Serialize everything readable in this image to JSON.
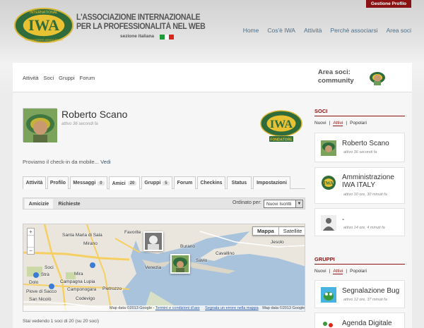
{
  "header": {
    "gestione_label": "Gestione Profilo",
    "title_line1": "L'ASSOCIAZIONE INTERNAZIONALE",
    "title_line2": "PER LA PROFESSIONALITÀ NEL WEB",
    "subtitle": "sezione italiana",
    "logo_text": "IWA",
    "logo_ring_top": "INTERNATIONAL",
    "logo_ring_bottom": "WEBMASTERS ASSOCIATION",
    "nav": [
      "Home",
      "Cos'è IWA",
      "Attività",
      "Perchè associarsi",
      "Area soci"
    ]
  },
  "subnav": {
    "links": [
      "Attività",
      "Soci",
      "Gruppi",
      "Forum"
    ],
    "area_label_line1": "Area soci:",
    "area_label_line2": "community"
  },
  "profile": {
    "name": "Roberto Scano",
    "activity": "attivo 36 secondi fa",
    "badge_label": "FONDATORE",
    "status_text": "Proviamo il check-in da mobile...",
    "status_link": "Vedi"
  },
  "tabs": [
    {
      "label": "Attività",
      "count": ""
    },
    {
      "label": "Profilo",
      "count": ""
    },
    {
      "label": "Messaggi",
      "count": "0"
    },
    {
      "label": "Amici",
      "count": "20"
    },
    {
      "label": "Gruppi",
      "count": "5"
    },
    {
      "label": "Forum",
      "count": ""
    },
    {
      "label": "Checkins",
      "count": ""
    },
    {
      "label": "Status",
      "count": ""
    },
    {
      "label": "Impostazioni",
      "count": ""
    }
  ],
  "subtabs": [
    "Amicizie",
    "Richieste"
  ],
  "order": {
    "label": "Ordinato per:",
    "selected": "Nuovi Iscritti"
  },
  "map": {
    "type_map": "Mappa",
    "type_sat": "Satellite",
    "labels": [
      "Santa Maria di Sala",
      "Mirano",
      "Favorite",
      "Burano",
      "Jesolo",
      "Venezia",
      "Cavallino",
      "Savio",
      "Soci",
      "Mira",
      "Dolo",
      "Strà",
      "Campagna Lupia",
      "Camponogara",
      "Piove di Sacco",
      "Codevigo",
      "San Nicolò",
      "Pietrozzo"
    ],
    "footer_data": "Map data ©2013 Google",
    "footer_terms": "Termini e condizioni d'uso",
    "footer_report": "Segnala un errore nella mappa",
    "footer_data2": "Map data ©2013 Google",
    "colors": {
      "water": "#a9c3dd",
      "land": "#eae6dd",
      "road": "#f6cf62"
    }
  },
  "members_count": "Stai vedendo 1 soci di 20 (su 20 soci)",
  "sidebar": {
    "soci_header": "SOCI",
    "soci_filters": [
      "Nuovi",
      "Attivi",
      "Popolari"
    ],
    "soci_active_filter": "Attivi",
    "members": [
      {
        "name": "Roberto Scano",
        "time": "attivo 36 secondi fa"
      },
      {
        "name": "Amministrazione IWA ITALY",
        "time": "attivo 10 ore, 30 minuti fa"
      },
      {
        "name": "-",
        "time": "attivo 14 ore, 4 minuti fa"
      }
    ],
    "gruppi_header": "GRUPPI",
    "gruppi_filters": [
      "Nuovi",
      "Attivi",
      "Popolari"
    ],
    "gruppi_active_filter": "Attivi",
    "groups": [
      {
        "name": "Segnalazione Bug",
        "time": "attivo 12 ore, 37 minuti fa"
      },
      {
        "name": "Agenda Digitale",
        "time": ""
      }
    ]
  },
  "colors": {
    "brand": "#8b1212",
    "nav": "#4d6f87",
    "logo_green": "#2f6b3b",
    "logo_gold": "#e8c233"
  }
}
